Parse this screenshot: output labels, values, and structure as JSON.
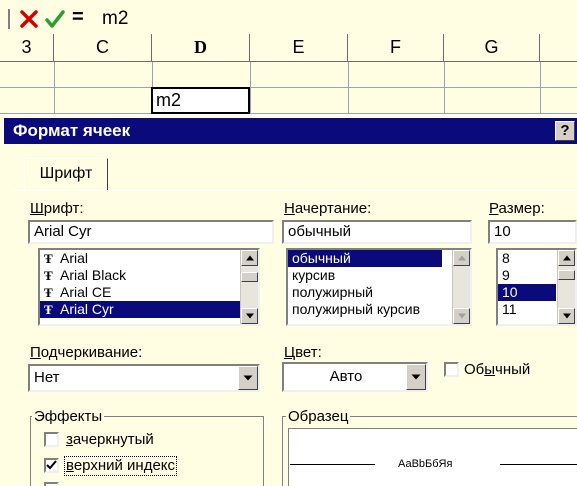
{
  "formula_bar": {
    "cancel_icon": "close-icon",
    "enter_icon": "check-icon",
    "function_symbol": "=",
    "content": "m2"
  },
  "sheet": {
    "columns": [
      "3",
      "C",
      "D",
      "E",
      "F",
      "G"
    ],
    "selected_column": "D",
    "active_cell_value": "m2"
  },
  "dialog": {
    "title": "Формат ячеек",
    "help_label": "?",
    "tab_label": "Шрифт",
    "font": {
      "label_accel": "Ш",
      "label_rest": "рифт:",
      "value": "Arial Cyr",
      "items": [
        "Arial",
        "Arial Black",
        "Arial CE",
        "Arial Cyr"
      ],
      "item_icon": "Ŧ"
    },
    "style": {
      "label_accel": "Н",
      "label_rest": "ачертание:",
      "value": "обычный",
      "items": [
        "обычный",
        "курсив",
        "полужирный",
        "полужирный курсив"
      ]
    },
    "size": {
      "label_accel": "Р",
      "label_rest": "азмер:",
      "value": "10",
      "items": [
        "8",
        "9",
        "10",
        "11"
      ]
    },
    "underline": {
      "label_accel": "П",
      "label_rest": "одчеркивание:",
      "value": "Нет"
    },
    "color": {
      "label_accel": "Ц",
      "label_rest": "вет:",
      "value": "Авто"
    },
    "normal_font": {
      "label_pre": "Об",
      "label_accel": "ы",
      "label_rest": "чный",
      "checked": false
    },
    "effects": {
      "title": "Эффекты",
      "strikethrough": {
        "label_accel": "з",
        "label_rest": "ачеркнутый",
        "checked": false
      },
      "superscript": {
        "label_accel": "в",
        "label_rest": "ерхний индекс",
        "checked": true
      }
    },
    "sample": {
      "title": "Образец",
      "text": "АаBbБбЯя"
    }
  },
  "colors": {
    "background": "#fffde2",
    "titlebar": "#0a0a7a",
    "selection": "#0a0a7a",
    "cancel_red": "#d40000",
    "enter_green": "#2aa02a"
  }
}
